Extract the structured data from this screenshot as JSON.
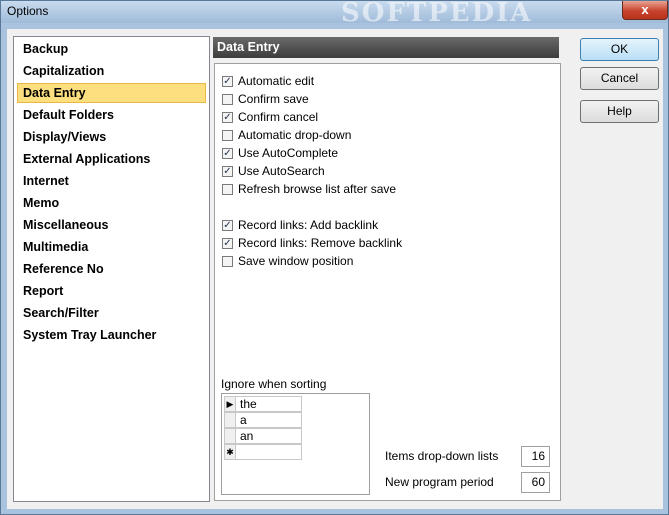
{
  "window": {
    "title": "Options",
    "watermark": "SOFTPEDIA",
    "close_glyph": "x"
  },
  "nav": {
    "items": [
      {
        "label": "Backup"
      },
      {
        "label": "Capitalization"
      },
      {
        "label": "Data Entry",
        "selected": true
      },
      {
        "label": "Default Folders"
      },
      {
        "label": "Display/Views"
      },
      {
        "label": "External Applications"
      },
      {
        "label": "Internet"
      },
      {
        "label": "Memo"
      },
      {
        "label": "Miscellaneous"
      },
      {
        "label": "Multimedia"
      },
      {
        "label": "Reference No"
      },
      {
        "label": "Report"
      },
      {
        "label": "Search/Filter"
      },
      {
        "label": "System Tray Launcher"
      }
    ]
  },
  "panel": {
    "title": "Data Entry",
    "checkboxes": [
      {
        "label": "Automatic edit",
        "checked": true
      },
      {
        "label": "Confirm save",
        "checked": false
      },
      {
        "label": "Confirm cancel",
        "checked": true
      },
      {
        "label": "Automatic drop-down",
        "checked": false
      },
      {
        "label": "Use AutoComplete",
        "checked": true
      },
      {
        "label": "Use AutoSearch",
        "checked": true
      },
      {
        "label": "Refresh browse list after save",
        "checked": false
      },
      {
        "label": "Record links: Add backlink",
        "checked": true
      },
      {
        "label": "Record links: Remove backlink",
        "checked": true
      },
      {
        "label": "Save window position",
        "checked": false
      }
    ],
    "ignore_label": "Ignore when sorting",
    "ignore_rows": [
      {
        "marker": "▶",
        "value": "the"
      },
      {
        "marker": "",
        "value": "a"
      },
      {
        "marker": "",
        "value": "an"
      },
      {
        "marker": "✱",
        "value": ""
      }
    ],
    "items_dropdown": {
      "label": "Items drop-down lists",
      "value": "16"
    },
    "new_program_period": {
      "label": "New program period",
      "value": "60"
    }
  },
  "buttons": {
    "ok": "OK",
    "cancel": "Cancel",
    "help": "Help"
  },
  "icons": {
    "checkmark": "✓"
  }
}
